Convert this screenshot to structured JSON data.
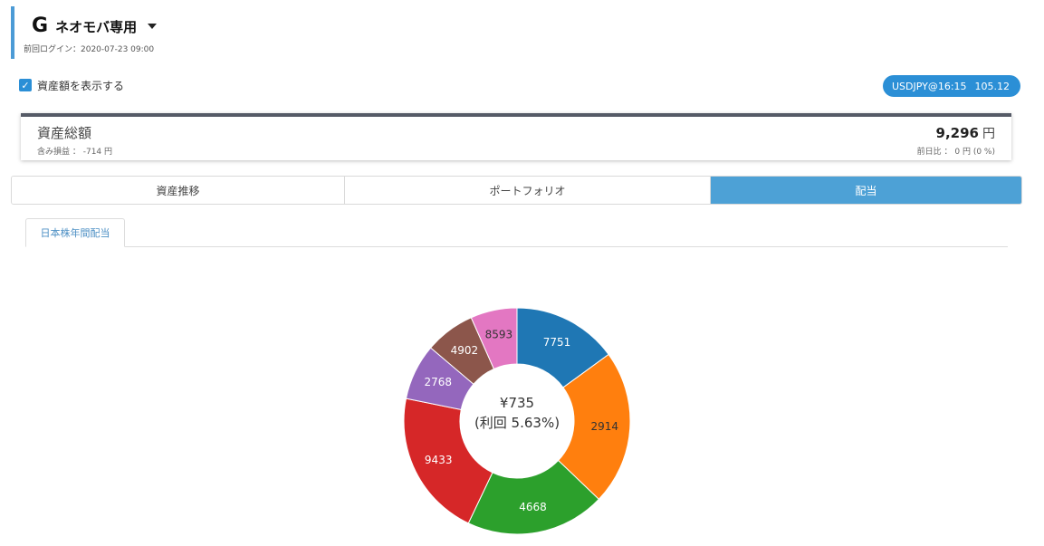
{
  "header": {
    "brand_logo": "G",
    "brand_name": "ネオモバ専用",
    "last_login": "前回ログイン：2020-07-23 09:00"
  },
  "show_assets": {
    "label": "資産額を表示する",
    "checked": true,
    "check_glyph": "✓"
  },
  "fx": {
    "label": "USDJPY@16:15",
    "value": "105.12"
  },
  "total": {
    "title": "資産総額",
    "unrealized_pl": "含み損益 ： -714 円",
    "value": "9,296",
    "unit": "円",
    "day_change": "前日比 ： 0 円 (0 %)"
  },
  "tabs": [
    {
      "label": "資産推移",
      "active": false
    },
    {
      "label": "ポートフォリオ",
      "active": false
    },
    {
      "label": "配当",
      "active": true
    }
  ],
  "subtab": {
    "label": "日本株年間配当"
  },
  "colors": {
    "accent": "#2b8fd6",
    "active_tab": "#4da1d6"
  },
  "chart_data": {
    "type": "pie",
    "donut": true,
    "center_text": [
      "¥735",
      "(利回 5.63%)"
    ],
    "slices": [
      {
        "label": "7751",
        "value": 88,
        "color": "#1f77b4",
        "label_color": "#ffffff"
      },
      {
        "label": "2914",
        "value": 130,
        "color": "#ff7f0e",
        "label_color": "#333333"
      },
      {
        "label": "4668",
        "value": 117,
        "color": "#2ca02c",
        "label_color": "#ffffff"
      },
      {
        "label": "9433",
        "value": 124,
        "color": "#d62728",
        "label_color": "#ffffff"
      },
      {
        "label": "2768",
        "value": 47,
        "color": "#9467bd",
        "label_color": "#ffffff"
      },
      {
        "label": "4902",
        "value": 42,
        "color": "#8c564b",
        "label_color": "#ffffff"
      },
      {
        "label": "8593",
        "value": 39,
        "color": "#e377c2",
        "label_color": "#333333"
      }
    ]
  }
}
